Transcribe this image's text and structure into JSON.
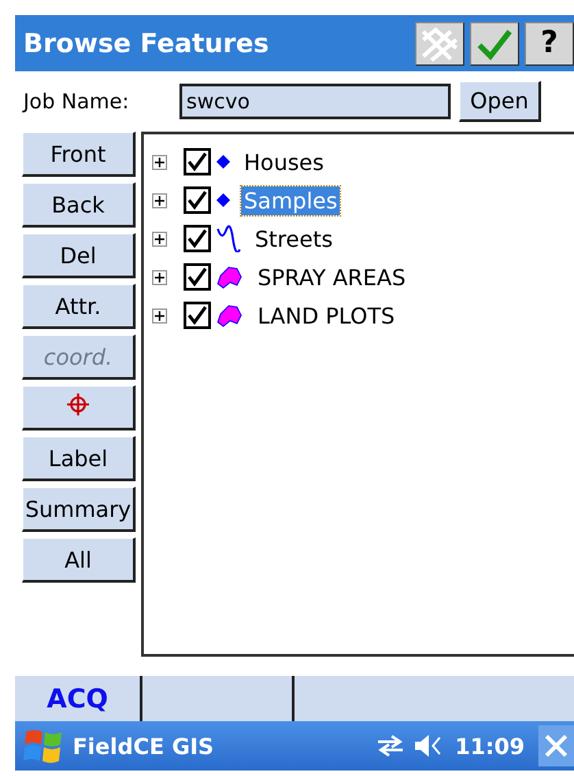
{
  "window": {
    "title": "Browse Features"
  },
  "title_buttons": [
    {
      "kind": "map"
    },
    {
      "kind": "ok"
    },
    {
      "kind": "help",
      "label": "?"
    }
  ],
  "job": {
    "label": "Job Name:",
    "value": "swcvo",
    "button": "Open"
  },
  "side_buttons": [
    {
      "kind": "text",
      "label": "Front",
      "disabled": false
    },
    {
      "kind": "text",
      "label": "Back",
      "disabled": false
    },
    {
      "kind": "text",
      "label": "Del",
      "disabled": false
    },
    {
      "kind": "text",
      "label": "Attr.",
      "disabled": false
    },
    {
      "kind": "text",
      "label": "coord.",
      "disabled": true
    },
    {
      "kind": "crosshair",
      "disabled": false
    },
    {
      "kind": "text",
      "label": "Label",
      "disabled": false
    },
    {
      "kind": "text",
      "label": "Summary",
      "disabled": false
    },
    {
      "kind": "text",
      "label": "All",
      "disabled": false
    }
  ],
  "layers": [
    {
      "name": "Houses",
      "checked": true,
      "selected": false,
      "expanded": false,
      "kind": "point",
      "color": "#0000ff"
    },
    {
      "name": "Samples",
      "checked": true,
      "selected": true,
      "expanded": false,
      "kind": "point",
      "color": "#0000ff"
    },
    {
      "name": "Streets",
      "checked": true,
      "selected": false,
      "expanded": false,
      "kind": "line",
      "color": "#0000ff"
    },
    {
      "name": "SPRAY AREAS",
      "checked": true,
      "selected": false,
      "expanded": false,
      "kind": "polygon",
      "color": "#ff00ff"
    },
    {
      "name": "LAND PLOTS",
      "checked": true,
      "selected": false,
      "expanded": false,
      "kind": "polygon",
      "color": "#ff00ff"
    }
  ],
  "menu_bar": {
    "items": [
      {
        "label": "ACQ"
      }
    ]
  },
  "taskbar": {
    "app": "FieldCE GIS",
    "time": "11:09"
  }
}
